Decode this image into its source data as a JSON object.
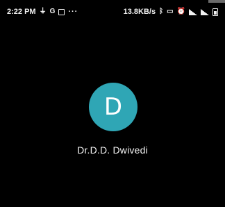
{
  "status_bar": {
    "time": "2:22 PM",
    "left_icons": [
      "usb-icon",
      "google-icon",
      "notification-box-icon"
    ],
    "overflow": "···",
    "network_speed": "13.8KB/s",
    "right_icons": [
      "bluetooth-icon",
      "vibrate-icon",
      "alarm-icon",
      "sim-signal-icon",
      "wifi-icon",
      "battery-icon"
    ]
  },
  "contact": {
    "initial": "D",
    "name": "Dr.D.D. Dwivedi",
    "avatar_color": "#2fa6b5"
  }
}
